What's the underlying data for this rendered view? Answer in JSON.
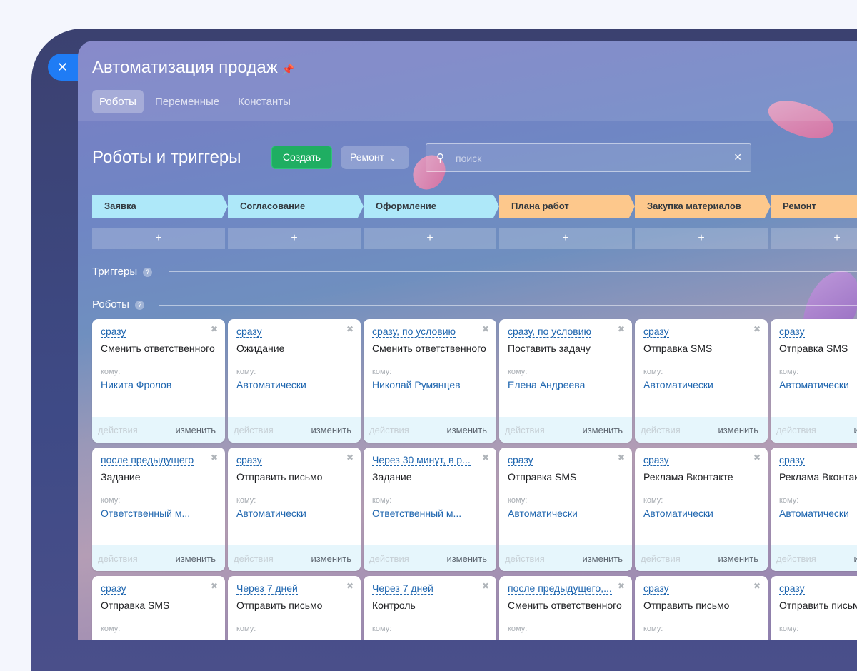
{
  "close_icon": "✕",
  "title": "Автоматизация продаж",
  "tabs": [
    {
      "label": "Роботы"
    },
    {
      "label": "Переменные"
    },
    {
      "label": "Константы"
    }
  ],
  "section_title": "Роботы и триггеры",
  "create_label": "Создать",
  "filter_label": "Ремонт",
  "search_placeholder": "поиск",
  "stages": [
    {
      "label": "Заявка",
      "color": "#aee8f9"
    },
    {
      "label": "Согласование",
      "color": "#aee8f9"
    },
    {
      "label": "Оформление",
      "color": "#aee8f9"
    },
    {
      "label": "Плана работ",
      "color": "#fdc88c"
    },
    {
      "label": "Закупка материалов",
      "color": "#fdc88c"
    },
    {
      "label": "Ремонт",
      "color": "#fdc88c"
    }
  ],
  "add_label": "+",
  "triggers_label": "Триггеры",
  "robots_label": "Роботы",
  "help_icon": "?",
  "card_labels": {
    "to": "кому:",
    "actions": "действия",
    "edit": "изменить"
  },
  "cards": [
    [
      {
        "when": "сразу",
        "name": "Сменить ответственного",
        "who": "Никита Фролов"
      },
      {
        "when": "после предыдущего",
        "name": "Задание",
        "who": "Ответственный м..."
      },
      {
        "when": "сразу",
        "name": "Отправка SMS",
        "who": ""
      }
    ],
    [
      {
        "when": "сразу",
        "name": "Ожидание",
        "who": "Автоматически"
      },
      {
        "when": "сразу",
        "name": "Отправить письмо",
        "who": "Автоматически"
      },
      {
        "when": "Через 7 дней",
        "name": "Отправить письмо",
        "who": ""
      }
    ],
    [
      {
        "when": "сразу, по условию",
        "name": "Сменить ответственного",
        "who": "Николай Румянцев"
      },
      {
        "when": "Через 30 минут, в р...",
        "name": "Задание",
        "who": "Ответственный м..."
      },
      {
        "when": "Через 7 дней",
        "name": "Контроль",
        "who": ""
      }
    ],
    [
      {
        "when": "сразу, по условию",
        "name": "Поставить задачу",
        "who": "Елена Андреева"
      },
      {
        "when": "сразу",
        "name": "Отправка SMS",
        "who": "Автоматически"
      },
      {
        "when": "после предыдущего,...",
        "name": "Сменить ответственного",
        "who": ""
      }
    ],
    [
      {
        "when": "сразу",
        "name": "Отправка SMS",
        "who": "Автоматически"
      },
      {
        "when": "сразу",
        "name": "Реклама Вконтакте",
        "who": "Автоматически"
      },
      {
        "when": "сразу",
        "name": "Отправить письмо",
        "who": ""
      }
    ],
    [
      {
        "when": "сразу",
        "name": "Отправка SMS",
        "who": "Автоматически"
      },
      {
        "when": "сразу",
        "name": "Реклама Вконтакте",
        "who": "Автоматически"
      },
      {
        "when": "сразу",
        "name": "Отправить письмо",
        "who": ""
      }
    ]
  ]
}
